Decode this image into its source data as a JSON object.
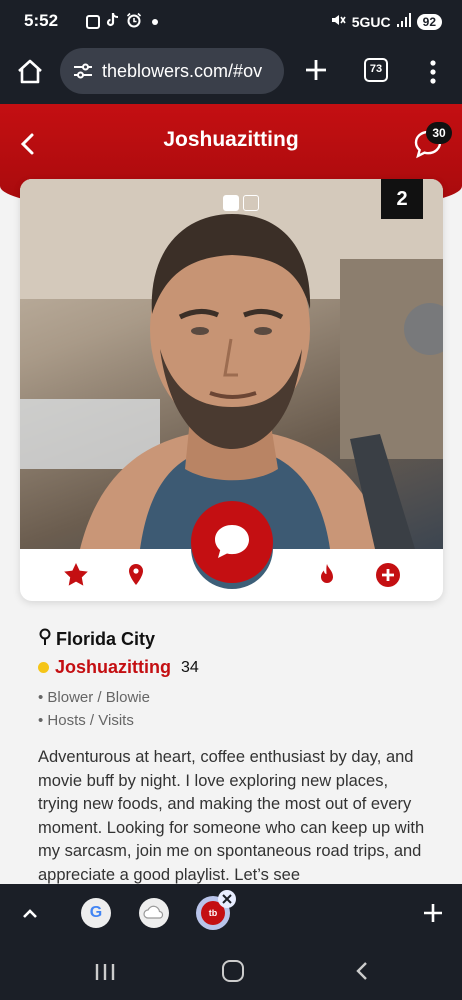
{
  "status_bar": {
    "time": "5:52",
    "network": "5GUC",
    "battery": "92"
  },
  "browser": {
    "url": "theblowers.com/#ov",
    "tab_count": "73"
  },
  "header": {
    "title": "Joshuazitting",
    "chat_badge": "30"
  },
  "photo": {
    "counter": "2"
  },
  "profile": {
    "city": "Florida City",
    "name": "Joshuazitting",
    "age": "34",
    "tags": [
      "• Blower / Blowie",
      "• Hosts / Visits"
    ],
    "bio": "Adventurous at heart, coffee enthusiast by day, and movie buff by night. I love exploring new places, trying new foods, and making the most out of every moment. Looking for someone who can keep up with my sarcasm, join me on spontaneous road trips, and appreciate a good playlist. Let’s see"
  },
  "tab_strip": {
    "google_tab": "G",
    "active_tab": "tb"
  },
  "colors": {
    "brand_red": "#c40f12",
    "online": "#f5c518"
  }
}
